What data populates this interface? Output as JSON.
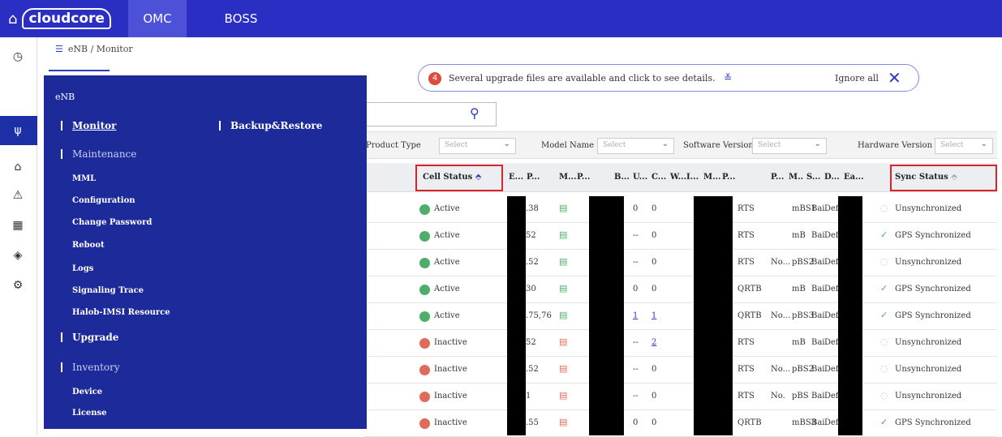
{
  "brand": {
    "name": "cloudcore"
  },
  "top_tabs": [
    {
      "label": "OMC"
    },
    {
      "label": "BOSS"
    }
  ],
  "breadcrumb": {
    "text": "eNB / Monitor"
  },
  "notice": {
    "count": "4",
    "message": "Several upgrade files are available and click to see details.",
    "ignore_label": "Ignore all"
  },
  "filters": [
    {
      "label": "Product Type",
      "placeholder": "Select"
    },
    {
      "label": "Model Name",
      "placeholder": "Select"
    },
    {
      "label": "Software Version",
      "placeholder": "Select"
    },
    {
      "label": "Hardware Version",
      "placeholder": "Select"
    }
  ],
  "table": {
    "columns": [
      "Cell Status",
      "E...",
      "P...",
      "M...",
      "P...",
      "B...",
      "U...",
      "C...",
      "W...",
      "I...",
      "M...",
      "P...",
      "P...",
      "M..",
      "S...",
      "D...",
      "Ea...",
      "Sync Status"
    ],
    "rows": [
      {
        "cell_status": "Active",
        "e": ".38",
        "u": "0",
        "c": "0",
        "p": "RTS",
        "pp": "",
        "m": "mBS1",
        "s": "Bai",
        "d": "Def.",
        "sync": "Unsynchronized"
      },
      {
        "cell_status": "Active",
        "e": "52",
        "u": "--",
        "c": "0",
        "p": "RTS",
        "pp": "",
        "m": "mB",
        "s": "Bai",
        "d": "Def",
        "sync": "GPS Synchronized"
      },
      {
        "cell_status": "Active",
        "e": ".52",
        "u": "--",
        "c": "0",
        "p": "RTS",
        "pp": "No...",
        "m": "pBS2",
        "s": "Bai",
        "d": "Def.",
        "sync": "Unsynchronized"
      },
      {
        "cell_status": "Active",
        "e": "30",
        "u": "0",
        "c": "0",
        "p": "QRTB",
        "pp": "",
        "m": "mB",
        "s": "Bai",
        "d": "Def",
        "sync": "GPS Synchronized"
      },
      {
        "cell_status": "Active",
        "e": ".75,76",
        "u": "1",
        "c": "1",
        "p": "QRTB",
        "pp": "No...",
        "m": "pBS3",
        "s": "Bai",
        "d": "Def.",
        "sync": "GPS Synchronized"
      },
      {
        "cell_status": "Inactive",
        "e": "52",
        "u": "--",
        "c": "2",
        "p": "RTS",
        "pp": "",
        "m": "mB",
        "s": "Bai",
        "d": "Def",
        "sync": "Unsynchronized"
      },
      {
        "cell_status": "Inactive",
        "e": ".52",
        "u": "--",
        "c": "0",
        "p": "RTS",
        "pp": "No...",
        "m": "pBS2",
        "s": "Bai",
        "d": "Def.",
        "sync": "Unsynchronized"
      },
      {
        "cell_status": "Inactive",
        "e": "1",
        "u": "--",
        "c": "0",
        "p": "RTS",
        "pp": "No.",
        "m": "pBS",
        "s": "Bai",
        "d": "Def",
        "sync": "Unsynchronized"
      },
      {
        "cell_status": "Inactive",
        "e": ".55",
        "u": "0",
        "c": "0",
        "p": "QRTB",
        "pp": "",
        "m": "mBS3",
        "s": "Bai",
        "d": "Def.",
        "sync": "GPS Synchronized"
      }
    ]
  },
  "overlay": {
    "title": "eNB",
    "sections": [
      {
        "label": "Monitor"
      },
      {
        "label": "Backup&Restore"
      },
      {
        "label": "Maintenance"
      },
      {
        "label": "Upgrade"
      },
      {
        "label": "Inventory"
      }
    ],
    "maintenance_items": [
      "MML",
      "Configuration",
      "Change Password",
      "Reboot",
      "Logs",
      "Signaling Trace",
      "Halob-IMSI Resource"
    ],
    "inventory_items": [
      "Device",
      "License"
    ]
  },
  "colors": {
    "primary": "#2a2ec2",
    "overlay": "#1d2a9a",
    "active": "#4cae6a",
    "inactive": "#e06b5a",
    "highlight": "#d9232a"
  }
}
